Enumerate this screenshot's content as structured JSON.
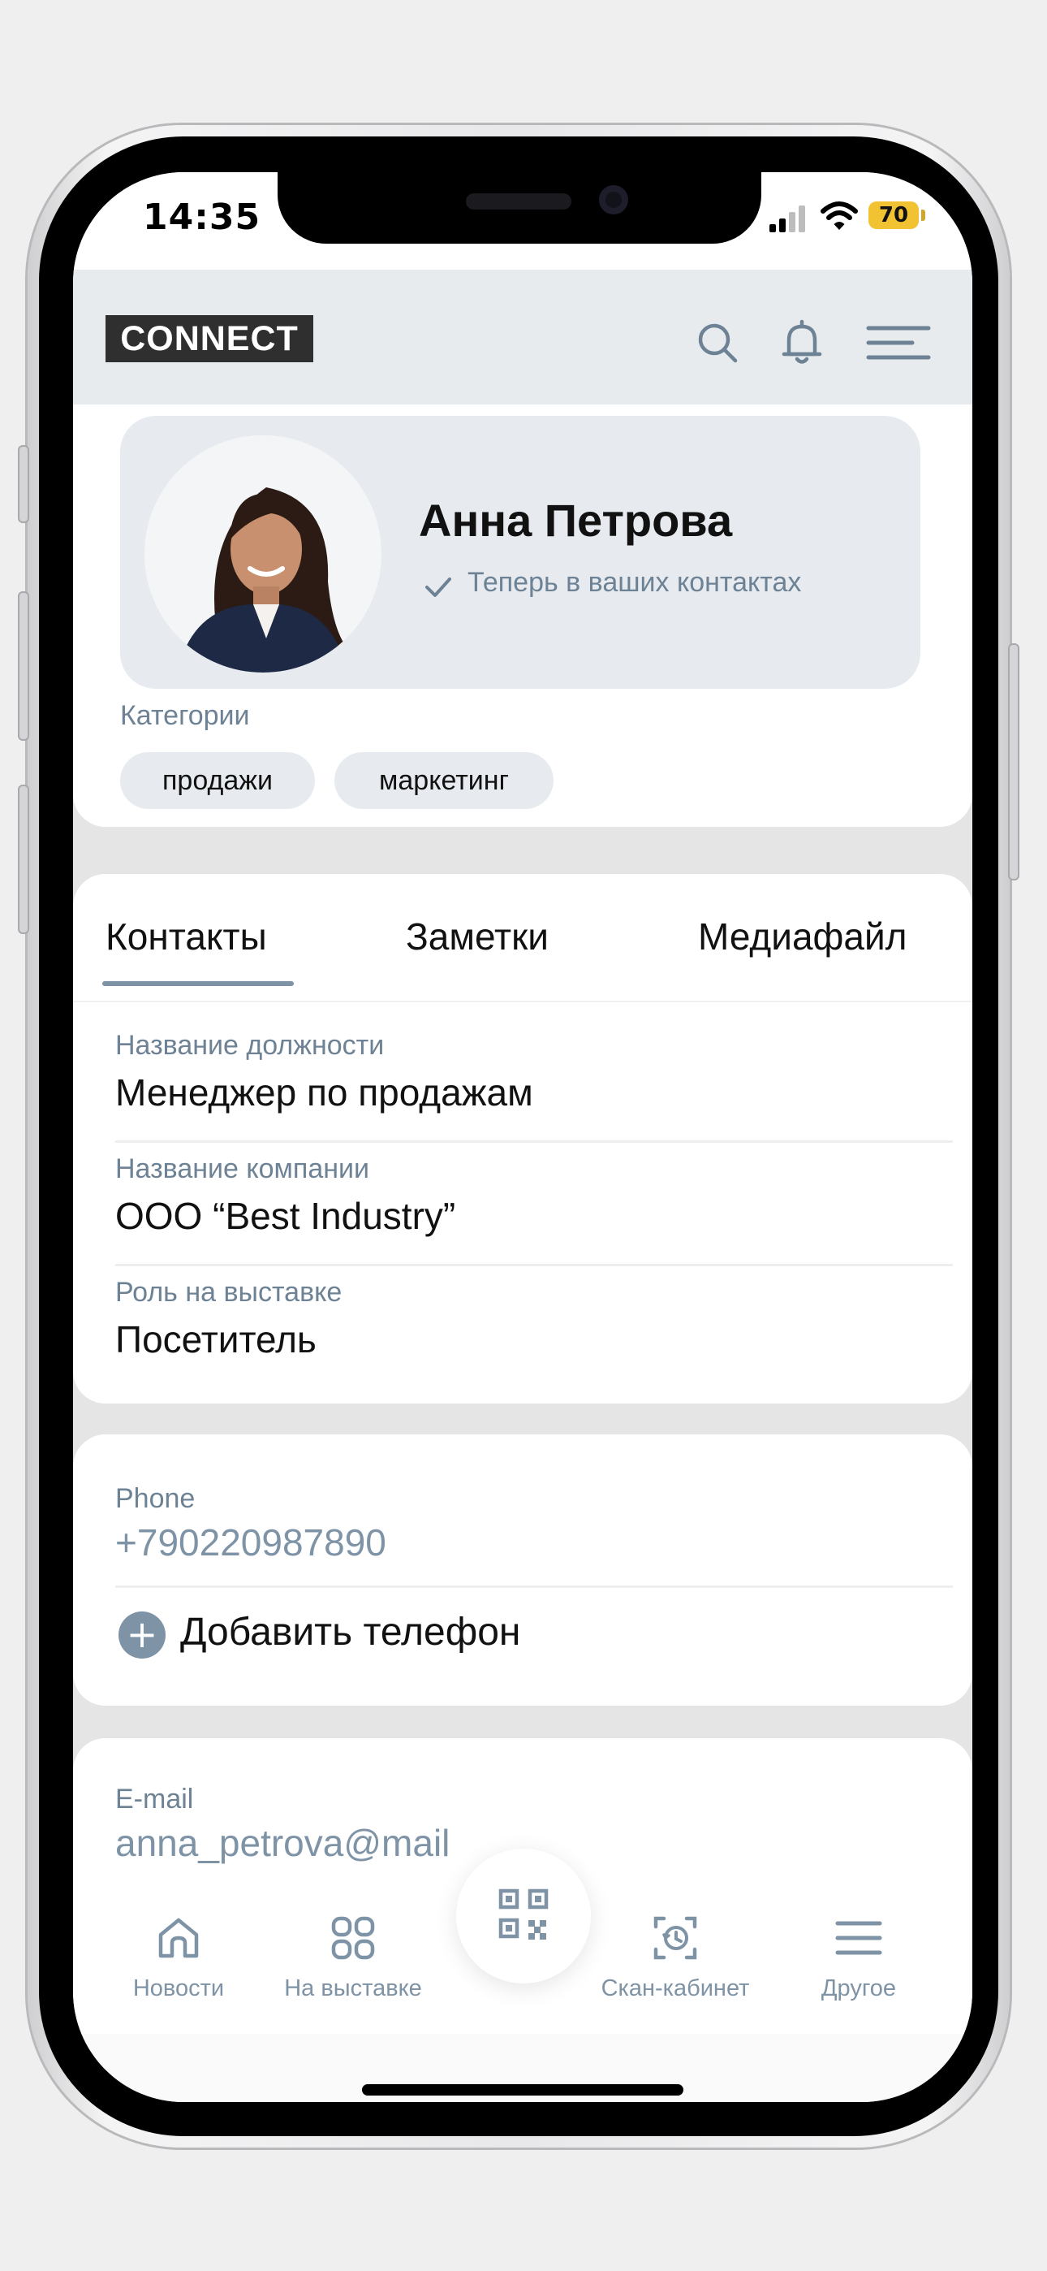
{
  "status_bar": {
    "time": "14:35",
    "battery": "70"
  },
  "header": {
    "logo": "CONNECT",
    "search_icon": "search-icon",
    "bell_icon": "bell-icon",
    "menu_icon": "menu-icon"
  },
  "profile": {
    "name": "Анна Петрова",
    "status": "Теперь в ваших контактах",
    "categories_label": "Категории",
    "categories": [
      "продажи",
      "маркетинг"
    ]
  },
  "tabs": [
    {
      "label": "Контакты",
      "active": true
    },
    {
      "label": "Заметки",
      "active": false
    },
    {
      "label": "Медиафайл",
      "active": false
    }
  ],
  "fields": [
    {
      "label": "Название должности",
      "value": "Менеджер по продажам"
    },
    {
      "label": "Название компании",
      "value": "ООО “Best Industry”"
    },
    {
      "label": "Роль на выставке",
      "value": "Посетитель"
    }
  ],
  "phone": {
    "label": "Phone",
    "value": "+790220987890",
    "add_label": "Добавить телефон"
  },
  "email": {
    "label": "E-mail",
    "value": "anna_petrova@mail"
  },
  "nav": [
    {
      "label": "Новости",
      "icon": "home-icon"
    },
    {
      "label": "На выставке",
      "icon": "grid-icon"
    },
    {
      "label": "Скан-кабинет",
      "icon": "history-icon"
    },
    {
      "label": "Другое",
      "icon": "menu-icon"
    }
  ],
  "colors": {
    "accent": "#7e93a6",
    "header_bg": "#e8ebee",
    "battery": "#f1c232"
  }
}
